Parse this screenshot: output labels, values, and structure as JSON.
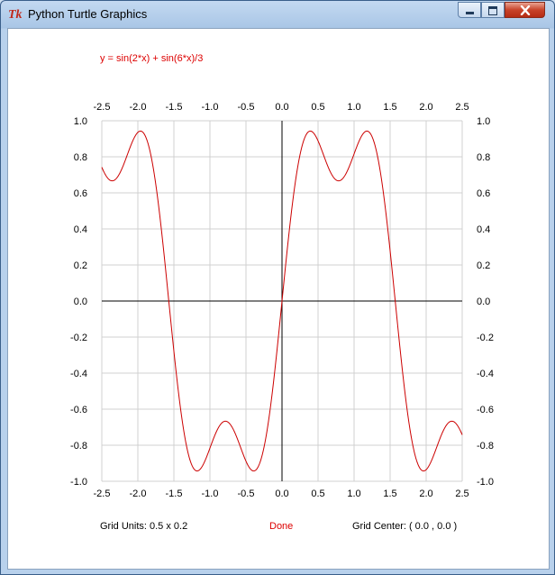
{
  "window": {
    "title": "Python Turtle Graphics"
  },
  "equation": "y = sin(2*x) + sin(6*x)/3",
  "status": {
    "grid_units_label": "Grid Units:  0.5  x  0.2",
    "done": "Done",
    "grid_center_label": "Grid Center: (  0.0 ,  0.0 )"
  },
  "colors": {
    "curve": "#cc0000",
    "grid": "#d0d0d0",
    "axis": "#000000",
    "label_red": "#dd0000"
  },
  "chart_data": {
    "type": "line",
    "title": "y = sin(2*x) + sin(6*x)/3",
    "function": "sin(2*x) + sin(6*x)/3",
    "xlim": [
      -2.5,
      2.5
    ],
    "ylim": [
      -1.0,
      1.0
    ],
    "x_ticks": [
      "-2.5",
      "-2.0",
      "-1.5",
      "-1.0",
      "-0.5",
      "0.0",
      "0.5",
      "1.0",
      "1.5",
      "2.0",
      "2.5"
    ],
    "y_ticks": [
      "1.0",
      "0.8",
      "0.6",
      "0.4",
      "0.2",
      "0.0",
      "-0.2",
      "-0.4",
      "-0.6",
      "-0.8",
      "-1.0"
    ],
    "grid": true,
    "series": [
      {
        "x": [
          -2.5,
          -2.25,
          -2.0,
          -1.75,
          -1.5,
          -1.25,
          -1.0,
          -0.75,
          -0.5,
          -0.25,
          0.0,
          0.25,
          0.5,
          0.75,
          1.0,
          1.25,
          1.5,
          1.75,
          2.0,
          2.25,
          2.5
        ],
        "values": [
          0.74,
          0.7,
          0.93,
          0.64,
          -0.26,
          -0.91,
          -0.67,
          -0.67,
          -0.88,
          -0.14,
          0.0,
          0.81,
          0.88,
          0.67,
          0.67,
          0.91,
          0.26,
          -0.64,
          -0.93,
          -0.7,
          -0.74
        ]
      }
    ]
  }
}
